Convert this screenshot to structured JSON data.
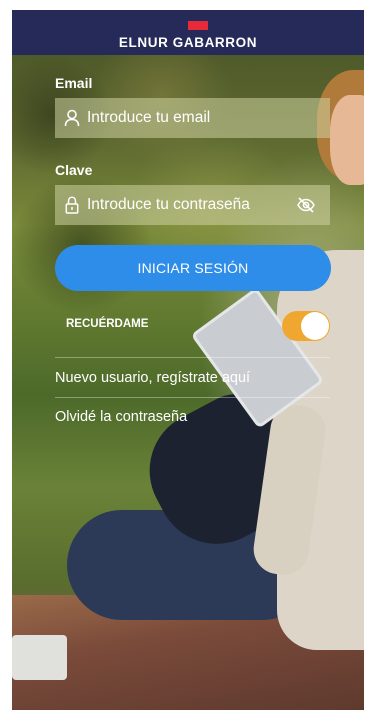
{
  "header": {
    "brand": "ELNUR GABARRON",
    "background": "#252a58",
    "mark_color": "#e8293a"
  },
  "form": {
    "email_label": "Email",
    "email_placeholder": "Introduce tu email",
    "password_label": "Clave",
    "password_placeholder": "Introduce tu contraseña",
    "submit_label": "INICIAR SESIÓN",
    "submit_color": "#2f8dea",
    "remember_label": "RECUÉRDAME",
    "remember_on": true,
    "toggle_color": "#f0a730"
  },
  "links": {
    "register": "Nuevo usuario, regístrate aquí",
    "forgot": "Olvidé la contraseña"
  },
  "icons": {
    "email": "user-icon",
    "password": "lock-icon",
    "visibility": "eye-off-icon"
  }
}
